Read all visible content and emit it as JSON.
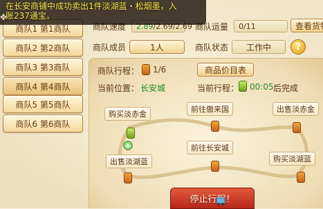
{
  "notice": {
    "line1": "在长安商铺中成功卖出1件淡湖蓝・松烟墨，入",
    "line2": "账237通宝。"
  },
  "teams": [
    {
      "label": "商队1 第1商队"
    },
    {
      "label": "商队2 第2商队"
    },
    {
      "label": "商队3 第3商队"
    },
    {
      "label": "商队4 第4商队"
    },
    {
      "label": "商队5 第5商队"
    },
    {
      "label": "商队6 第6商队"
    }
  ],
  "info": {
    "speed_label": "商队速度",
    "speed_current": "2.89",
    "speed_rest": "/2.69/2.69",
    "cargo_label": "商队运量",
    "cargo_value": "0/11",
    "view_goods_button": "查看货物",
    "members_label": "商队成员",
    "members_value": "1人",
    "status_label": "商队状态",
    "status_value": "工作中",
    "help_icon": "?"
  },
  "journey": {
    "trip_label": "商队行程：",
    "trip_value": "1/6",
    "goods_catalog_button": "商品价目表",
    "location_label": "当前位置：",
    "location_value": "长安城",
    "current_trip_label": "当前行程：",
    "time_value": "00:05",
    "finish_suffix": "后完成"
  },
  "route": {
    "nodes": [
      {
        "label": "购买淡赤金"
      },
      {
        "label": "前往傲来国"
      },
      {
        "label": "出售淡赤金"
      },
      {
        "label": "出售淡湖蓝"
      },
      {
        "label": "前往长安城"
      },
      {
        "label": "购买淡湖蓝"
      }
    ]
  },
  "stop_button": "停止行程！",
  "colors": {
    "accent_green": "#1f8c2a",
    "stop_red": "#b4271a",
    "notice_yellow": "#ffe94a"
  }
}
